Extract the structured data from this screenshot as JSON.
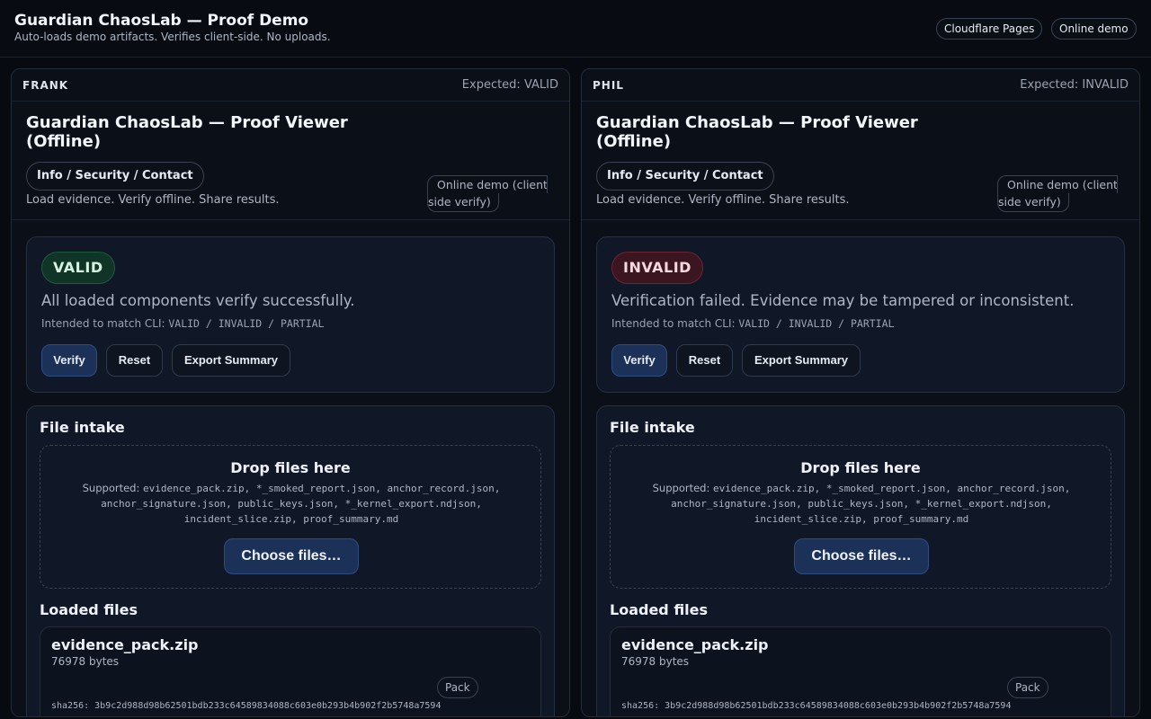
{
  "header": {
    "title": "Guardian ChaosLab — Proof Demo",
    "subtitle": "Auto-loads demo artifacts. Verifies client-side. No uploads.",
    "links": [
      "Cloudflare Pages",
      "Online demo"
    ]
  },
  "panels": [
    {
      "name": "FRANK",
      "expected": "Expected: VALID",
      "viewer_title": "Guardian ChaosLab — Proof Viewer (Offline)",
      "info_button": "Info / Security / Contact",
      "online_chip_line1": "Online demo (client-",
      "online_chip_line2": "side verify)",
      "description": "Load evidence. Verify offline. Share results.",
      "status_badge": "VALID",
      "status_color": "#1f5a3f",
      "status_message": "All loaded components verify successfully.",
      "cli_prefix": "Intended to match CLI: ",
      "cli_values": "VALID / INVALID / PARTIAL",
      "buttons": {
        "verify": "Verify",
        "reset": "Reset",
        "export": "Export Summary"
      },
      "intake": {
        "title": "File intake",
        "drop_title": "Drop files here",
        "supported_prefix": "Supported: ",
        "supported_line1": "evidence_pack.zip, *_smoked_report.json, anchor_record.json,",
        "supported_line2": "anchor_signature.json, public_keys.json, *_kernel_export.ndjson,",
        "supported_line3": "incident_slice.zip, proof_summary.md",
        "choose_button": "Choose files…"
      },
      "loaded": {
        "title": "Loaded files",
        "files": [
          {
            "name": "evidence_pack.zip",
            "size": "76978 bytes",
            "tag": "Pack",
            "hash": "sha256: 3b9c2d988d98b62501bdb233c64589834088c603e0b293b4b902f2b5748a7594"
          }
        ]
      }
    },
    {
      "name": "PHIL",
      "expected": "Expected: INVALID",
      "viewer_title": "Guardian ChaosLab — Proof Viewer (Offline)",
      "info_button": "Info / Security / Contact",
      "online_chip_line1": "Online demo (client-",
      "online_chip_line2": "side verify)",
      "description": "Load evidence. Verify offline. Share results.",
      "status_badge": "INVALID",
      "status_color": "#6a2533",
      "status_message": "Verification failed. Evidence may be tampered or inconsistent.",
      "cli_prefix": "Intended to match CLI: ",
      "cli_values": "VALID / INVALID / PARTIAL",
      "buttons": {
        "verify": "Verify",
        "reset": "Reset",
        "export": "Export Summary"
      },
      "intake": {
        "title": "File intake",
        "drop_title": "Drop files here",
        "supported_prefix": "Supported: ",
        "supported_line1": "evidence_pack.zip, *_smoked_report.json, anchor_record.json,",
        "supported_line2": "anchor_signature.json, public_keys.json, *_kernel_export.ndjson,",
        "supported_line3": "incident_slice.zip, proof_summary.md",
        "choose_button": "Choose files…"
      },
      "loaded": {
        "title": "Loaded files",
        "files": [
          {
            "name": "evidence_pack.zip",
            "size": "76978 bytes",
            "tag": "Pack",
            "hash": "sha256: 3b9c2d988d98b62501bdb233c64589834088c603e0b293b4b902f2b5748a7594"
          }
        ]
      }
    }
  ]
}
